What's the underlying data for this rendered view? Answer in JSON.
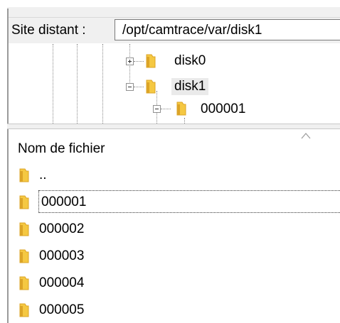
{
  "remote_site": {
    "label": "Site distant :",
    "path": "/opt/camtrace/var/disk1"
  },
  "tree": {
    "items": [
      {
        "label": "disk0",
        "expander": "plus",
        "selected": false
      },
      {
        "label": "disk1",
        "expander": "minus",
        "selected": true
      },
      {
        "label": "000001",
        "expander": "minus",
        "selected": false
      }
    ]
  },
  "file_list": {
    "column_header": "Nom de fichier",
    "sort_indicator": "ascending",
    "rows": [
      {
        "name": ".."
      },
      {
        "name": "000001"
      },
      {
        "name": "000002"
      },
      {
        "name": "000003"
      },
      {
        "name": "000004"
      },
      {
        "name": "000005"
      }
    ]
  },
  "colors": {
    "folder_fill": "#f5c842",
    "folder_shade": "#dca427",
    "panel_bg": "#f0f0f0",
    "selection_bg": "#eaeaea"
  },
  "icons": {
    "folder": "folder-icon",
    "expand": "plus-box-icon",
    "collapse": "minus-box-icon",
    "sort": "sort-ascending-icon"
  }
}
